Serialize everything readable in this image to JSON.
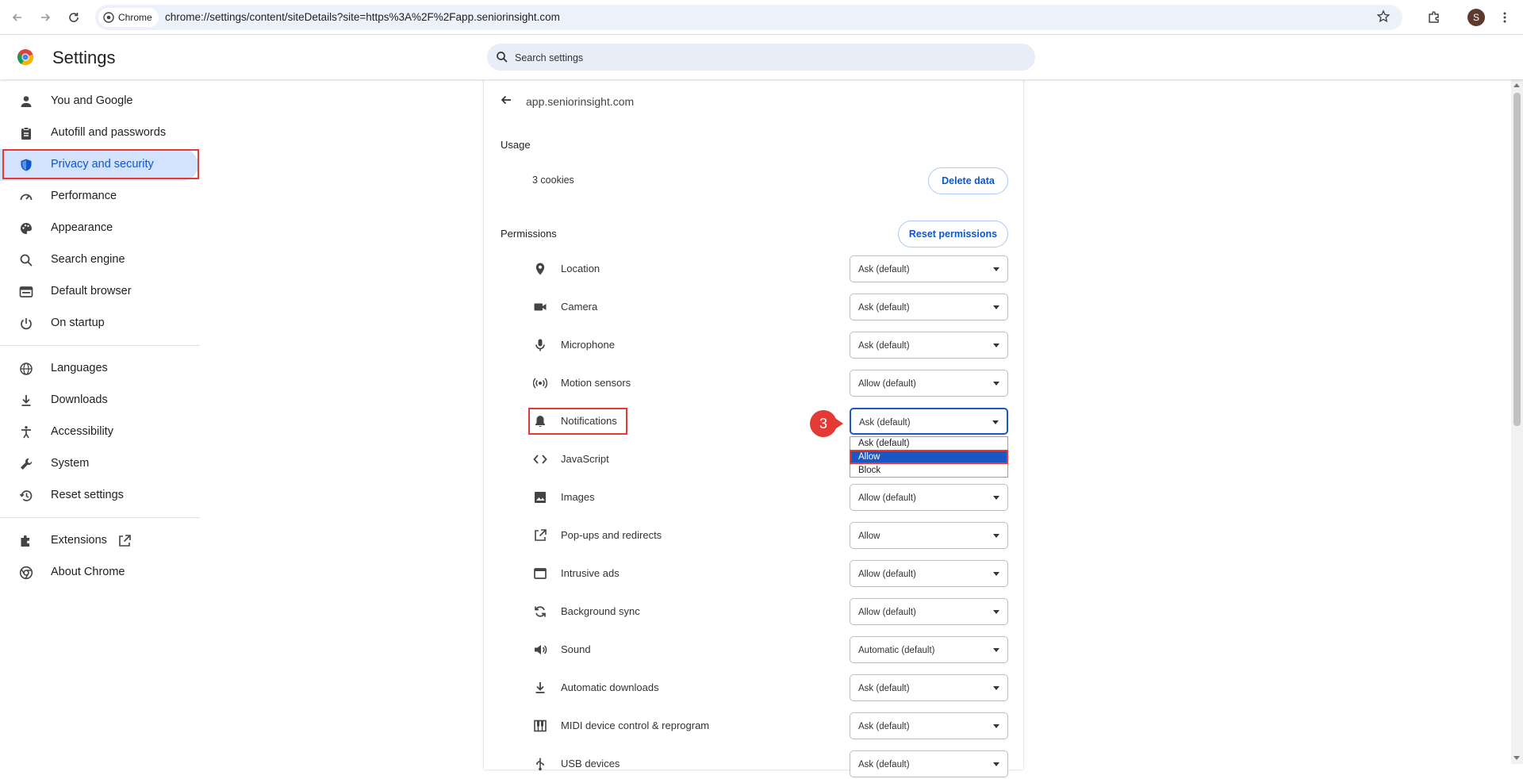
{
  "browser": {
    "chip_label": "Chrome",
    "url": "chrome://settings/content/siteDetails?site=https%3A%2F%2Fapp.seniorinsight.com",
    "profile_initial": "S"
  },
  "header": {
    "title": "Settings",
    "search_placeholder": "Search settings"
  },
  "sidebar": {
    "items": [
      {
        "label": "You and Google",
        "icon": "person-icon"
      },
      {
        "label": "Autofill and passwords",
        "icon": "clipboard-icon"
      },
      {
        "label": "Privacy and security",
        "icon": "shield-icon"
      },
      {
        "label": "Performance",
        "icon": "gauge-icon"
      },
      {
        "label": "Appearance",
        "icon": "palette-icon"
      },
      {
        "label": "Search engine",
        "icon": "search-icon"
      },
      {
        "label": "Default browser",
        "icon": "browser-icon"
      },
      {
        "label": "On startup",
        "icon": "power-icon"
      },
      {
        "label": "Languages",
        "icon": "globe-icon"
      },
      {
        "label": "Downloads",
        "icon": "download-icon"
      },
      {
        "label": "Accessibility",
        "icon": "accessibility-icon"
      },
      {
        "label": "System",
        "icon": "wrench-icon"
      },
      {
        "label": "Reset settings",
        "icon": "history-icon"
      },
      {
        "label": "Extensions",
        "icon": "puzzle-icon"
      },
      {
        "label": "About Chrome",
        "icon": "chrome-icon"
      }
    ]
  },
  "site": {
    "name": "app.seniorinsight.com",
    "usage_label": "Usage",
    "cookies": "3 cookies",
    "delete_button": "Delete data",
    "permissions_label": "Permissions",
    "reset_button": "Reset permissions"
  },
  "permissions": [
    {
      "label": "Location",
      "value": "Ask (default)",
      "icon": "location-pin-icon"
    },
    {
      "label": "Camera",
      "value": "Ask (default)",
      "icon": "camera-icon"
    },
    {
      "label": "Microphone",
      "value": "Ask (default)",
      "icon": "microphone-icon"
    },
    {
      "label": "Motion sensors",
      "value": "Allow (default)",
      "icon": "sensors-icon"
    },
    {
      "label": "Notifications",
      "value": "Ask (default)",
      "icon": "bell-icon"
    },
    {
      "label": "JavaScript",
      "value": "",
      "icon": "code-icon"
    },
    {
      "label": "Images",
      "value": "Allow (default)",
      "icon": "image-icon"
    },
    {
      "label": "Pop-ups and redirects",
      "value": "Allow",
      "icon": "open-in-new-icon"
    },
    {
      "label": "Intrusive ads",
      "value": "Allow (default)",
      "icon": "window-icon"
    },
    {
      "label": "Background sync",
      "value": "Allow (default)",
      "icon": "sync-icon"
    },
    {
      "label": "Sound",
      "value": "Automatic (default)",
      "icon": "speaker-icon"
    },
    {
      "label": "Automatic downloads",
      "value": "Ask (default)",
      "icon": "download-icon"
    },
    {
      "label": "MIDI device control & reprogram",
      "value": "Ask (default)",
      "icon": "piano-icon"
    },
    {
      "label": "USB devices",
      "value": "Ask (default)",
      "icon": "usb-icon"
    }
  ],
  "dropdown": {
    "options": [
      "Ask (default)",
      "Allow",
      "Block"
    ],
    "highlighted": "Allow"
  },
  "annotation": {
    "step": "3"
  },
  "colors": {
    "accent": "#0b57d0",
    "highlight_border": "#e53935",
    "active_nav_bg": "#d3e3fd"
  }
}
